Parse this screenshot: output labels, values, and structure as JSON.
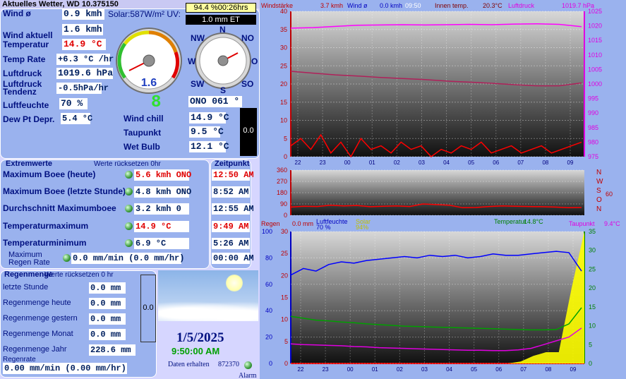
{
  "title": "Aktuelles Wetter, WD 10.375150",
  "top_box": {
    "solar_pct": "94.4 %00:26hrs",
    "et": "1.0 mm ET",
    "solar_label": "Solar:587W/m² UV:"
  },
  "current": {
    "wind_avg_label": "Wind ø",
    "wind_avg": "0.9 kmh",
    "wind_now_label": "Wind aktuell",
    "wind_now": "1.6 kmh",
    "temp_label": "Temperatur",
    "temp": "14.9 °C",
    "temp_rate_label": "Temp Rate",
    "temp_rate": "+6.3 °C /hr",
    "pressure_label": "Luftdruck",
    "pressure": "1019.6 hPa",
    "pressure_trend_label1": "Luftdruck",
    "pressure_trend_label2": "Tendenz",
    "pressure_trend": "-0.5hPa/hr",
    "humidity_label": "Luftfeuchte",
    "humidity": "70 %",
    "dewdep_label": "Dew Pt Depr.",
    "dewdep": "5.4 °C",
    "windchill_label": "Wind chill",
    "windchill": "14.9 °C",
    "dewpoint_label": "Taupunkt",
    "dewpoint": "9.5 °C",
    "wetbulb_label": "Wet Bulb",
    "wetbulb": "12.1 °C",
    "wind_dir": "ONO  061 °",
    "gauge_value": "1.6",
    "lcd_digit": "8",
    "rain_bar_value": "0.0"
  },
  "compass": {
    "N": "N",
    "NO": "NO",
    "O": "O",
    "SO": "SO",
    "S": "S",
    "SW": "SW",
    "W": "W",
    "NW": "NW"
  },
  "extremes": {
    "header": "Extremwerte",
    "reset_note": "Werte rücksetzen 0hr",
    "time_header": "Zeitpunkt",
    "rows": [
      {
        "label": "Maximum Boee (heute)",
        "value": "5.6 kmh ONO",
        "time": "12:50 AM",
        "red": true
      },
      {
        "label": "Maximum Boee (letzte Stunde)",
        "value": "4.8 kmh ONO",
        "time": "8:52 AM",
        "red": false
      },
      {
        "label": "Durchschnitt Maximumboee",
        "value": "3.2 kmh    0",
        "time": "12:55 AM",
        "red": false
      },
      {
        "label": "Temperaturmaximum",
        "value": "14.9 °C",
        "time": "9:49 AM",
        "red": true
      },
      {
        "label": "Temperaturminimum",
        "value": "6.9 °C",
        "time": "5:26 AM",
        "red": false
      },
      {
        "label": "Maximum\nRegen Rate",
        "value": "0.0 mm/min (0.0 mm/hr)",
        "time": "00:00 AM",
        "red": false
      }
    ]
  },
  "rain": {
    "header": "Regenmenge",
    "reset_note": "Werte rücksetzen 0 hr",
    "rows": [
      {
        "label": "letzte Stunde",
        "value": "0.0 mm"
      },
      {
        "label": "Regenmenge heute",
        "value": "0.0 mm"
      },
      {
        "label": "Regenmenge gestern",
        "value": "0.0 mm"
      },
      {
        "label": "Regenmenge Monat",
        "value": "0.0 mm"
      },
      {
        "label": "Regenmenge Jahr",
        "value": "228.6 mm"
      }
    ],
    "rate_label": "Regenrate",
    "rate": "0.00 mm/min (0.00 mm/hr)",
    "bar_value": "0.0"
  },
  "status": {
    "date": "1/5/2025",
    "time": "9:50:00 AM",
    "data_label": "Daten erhalten",
    "data_count": "872370",
    "alarm": "Alarm"
  },
  "colors": {
    "panel": "#9ab2ee",
    "label": "#001080",
    "red": "#e00000",
    "magenta": "#e000e0"
  },
  "chart_data": [
    {
      "type": "line",
      "legend": [
        {
          "text": "Windstärke",
          "color": "#c00000"
        },
        {
          "text": "3.7 kmh",
          "color": "#c00000"
        },
        {
          "text": "Wind ø",
          "color": "#0000c0"
        },
        {
          "text": "0.0 kmh",
          "color": "#0000c0"
        },
        {
          "text": "09:50",
          "color": "#ffffff"
        },
        {
          "text": "Innen temp.",
          "color": "#800000"
        },
        {
          "text": "20.3°C",
          "color": "#800000"
        },
        {
          "text": "Luftdruck",
          "color": "#e000e0"
        },
        {
          "text": "1019.7 hPa",
          "color": "#e000e0"
        }
      ],
      "x_ticks": [
        "22",
        "23",
        "00",
        "01",
        "02",
        "03",
        "04",
        "05",
        "06",
        "07",
        "08",
        "09"
      ],
      "y_left": {
        "min": 0,
        "max": 40,
        "ticks": [
          0,
          5,
          10,
          15,
          20,
          25,
          30,
          35,
          40
        ]
      },
      "y_right": {
        "min": 975,
        "max": 1025,
        "ticks": [
          975,
          980,
          985,
          990,
          995,
          1000,
          1005,
          1010,
          1015,
          1020,
          1025
        ]
      },
      "series": [
        {
          "name": "Luftdruck",
          "color": "#ff00ff",
          "axis": "right",
          "values": [
            1019.2,
            1019.4,
            1019.8,
            1020.2,
            1020.3,
            1020.4,
            1020.3,
            1020.4,
            1020.5,
            1020.4,
            1020.6,
            1020.7,
            1020.5,
            1019.7
          ]
        },
        {
          "name": "Innen temp.",
          "color": "#b0205a",
          "axis": "left",
          "values": [
            23.5,
            23.0,
            22.5,
            22.2,
            21.8,
            21.5,
            21.2,
            20.8,
            20.5,
            20.2,
            19.8,
            19.5,
            19.5,
            20.3
          ]
        },
        {
          "name": "Windstärke",
          "color": "#ff0000",
          "axis": "left",
          "values": [
            3,
            5,
            2,
            6,
            1,
            4,
            0,
            5,
            2,
            3,
            1,
            4,
            2,
            3,
            0,
            2,
            1,
            3,
            2,
            4,
            1,
            2,
            3,
            1,
            2,
            3,
            1,
            2,
            3,
            4
          ]
        }
      ]
    },
    {
      "type": "line",
      "y_ticks": [
        0,
        90,
        180,
        270,
        360
      ],
      "right_labels": [
        "N",
        "W",
        "S",
        "O",
        "N"
      ],
      "right_extra": "60",
      "series": [
        {
          "name": "Windrichtung",
          "color": "#ff0000",
          "values": [
            65,
            72,
            70,
            80,
            75,
            78,
            68,
            72,
            74,
            70,
            90,
            85,
            80,
            60,
            62,
            70,
            75,
            72,
            70,
            68,
            65,
            60,
            62
          ]
        }
      ]
    },
    {
      "type": "line",
      "legend": [
        {
          "text": "Regen",
          "color": "#c00000"
        },
        {
          "text": "0.0 mm",
          "color": "#c00000"
        },
        {
          "text": "Luftfeuchte",
          "color": "#0000c0"
        },
        {
          "text": "70 %",
          "color": "#0000c0"
        },
        {
          "text": "Solar",
          "color": "#c0c000"
        },
        {
          "text": "94%",
          "color": "#c0c000"
        },
        {
          "text": "Temperatur",
          "color": "#008000"
        },
        {
          "text": "14.8°C",
          "color": "#008000"
        },
        {
          "text": "Taupunkt",
          "color": "#e000e0"
        },
        {
          "text": "9.4°C",
          "color": "#e000e0"
        }
      ],
      "x_ticks": [
        "22",
        "23",
        "00",
        "01",
        "02",
        "03",
        "04",
        "05",
        "06",
        "07",
        "08",
        "09"
      ],
      "y_left": {
        "min": 0,
        "max": 30,
        "ticks": [
          0,
          5,
          10,
          15,
          20,
          25,
          30
        ]
      },
      "y_left2": {
        "min": 0,
        "max": 100,
        "ticks": [
          0,
          20,
          40,
          60,
          80,
          100
        ]
      },
      "y_right": {
        "min": 0,
        "max": 35,
        "ticks": [
          0,
          5,
          10,
          15,
          20,
          25,
          30,
          35
        ]
      },
      "series": [
        {
          "name": "Luftfeuchte",
          "color": "#0000ff",
          "values": [
            67,
            72,
            70,
            75,
            77,
            76,
            78,
            79,
            80,
            81,
            80,
            82,
            81,
            82,
            80,
            81,
            83,
            82,
            82,
            83,
            84,
            85,
            84,
            70
          ]
        },
        {
          "name": "Temperatur",
          "color": "#00a000",
          "values": [
            12.5,
            12.0,
            11.5,
            11.3,
            11.0,
            10.8,
            10.5,
            10.3,
            10.1,
            9.9,
            9.8,
            9.7,
            9.6,
            9.5,
            9.4,
            9.3,
            9.2,
            9.1,
            9.0,
            8.9,
            8.9,
            9.0,
            10.5,
            14.8
          ]
        },
        {
          "name": "Taupunkt",
          "color": "#e000e0",
          "values": [
            5.2,
            5.0,
            4.9,
            4.8,
            4.7,
            4.5,
            4.4,
            4.2,
            4.1,
            4.0,
            3.9,
            3.8,
            3.7,
            3.6,
            3.5,
            3.5,
            3.4,
            3.4,
            3.6,
            4.0,
            5.0,
            6.0,
            7.0,
            9.4
          ]
        },
        {
          "name": "Solar",
          "color": "#ffff00",
          "values": [
            0,
            0,
            0,
            0,
            0,
            0,
            0,
            0,
            0,
            0,
            0,
            0,
            0,
            0,
            0,
            0,
            0,
            0,
            0.5,
            2,
            3,
            3,
            20,
            35
          ]
        }
      ]
    }
  ]
}
